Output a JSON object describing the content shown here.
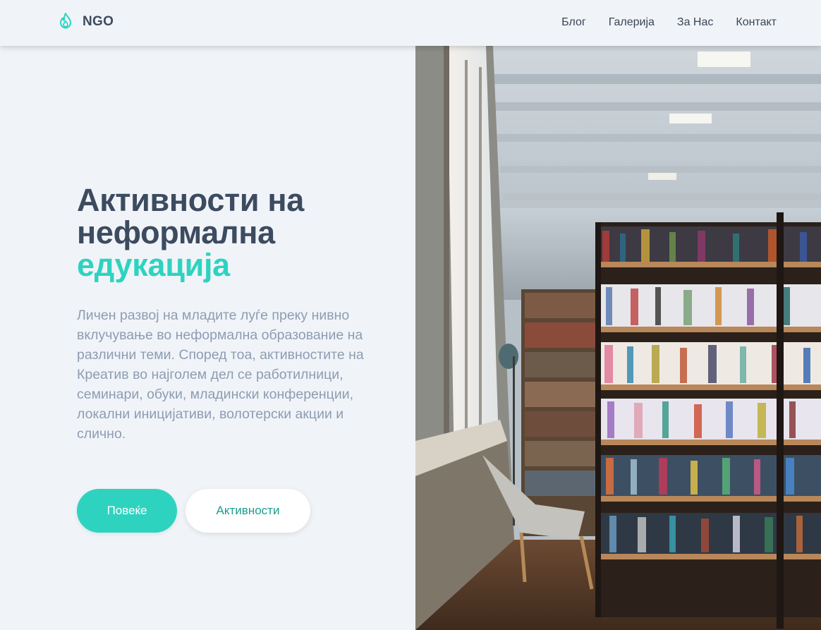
{
  "nav": {
    "brand": "NGO",
    "links": [
      "Блог",
      "Галерија",
      "За Нас",
      "Контакт"
    ]
  },
  "hero": {
    "title_lines": [
      "Активности на",
      "неформална"
    ],
    "title_accent": "едукација",
    "description": "Личен развој на младите луѓе преку нивно вклучување во неформална образование на различни теми. Според тоа, активностите на Креатив во најголем дел се работилници, семинари, обуки, младински конференции, локални иницијативи, волотерски акции и слично.",
    "primary_button": "Повеќе",
    "secondary_button": "Активности"
  },
  "colors": {
    "accent": "#2ed3c0",
    "heading": "#3d4b60",
    "body_text": "#8e9cb2",
    "background": "#f0f4f8"
  },
  "icons": {
    "logo": "flame-drop-icon"
  }
}
